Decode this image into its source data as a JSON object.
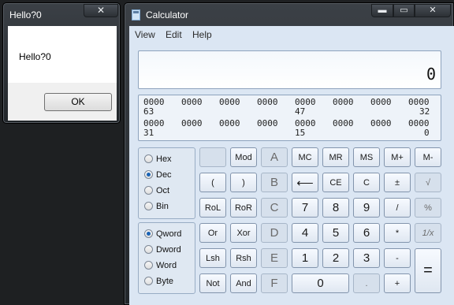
{
  "msgbox": {
    "title": "Hello?0",
    "close": "✕",
    "text": "Hello?0",
    "ok": "OK"
  },
  "calc": {
    "title": "Calculator",
    "controls": {
      "minimize": "▬",
      "maximize": "▭",
      "close": "✕"
    },
    "menu": [
      "View",
      "Edit",
      "Help"
    ],
    "display": "0",
    "bits": {
      "row1": [
        "0000",
        "0000",
        "0000",
        "0000",
        "0000",
        "0000",
        "0000",
        "0000"
      ],
      "row1_idx": [
        "63",
        "47",
        "32"
      ],
      "row2": [
        "0000",
        "0000",
        "0000",
        "0000",
        "0000",
        "0000",
        "0000",
        "0000"
      ],
      "row2_idx": [
        "31",
        "15",
        "0"
      ]
    },
    "base": {
      "options": [
        "Hex",
        "Dec",
        "Oct",
        "Bin"
      ],
      "selected": "Dec"
    },
    "word": {
      "options": [
        "Qword",
        "Dword",
        "Word",
        "Byte"
      ],
      "selected": "Qword"
    },
    "keys": {
      "mod": "Mod",
      "A": "A",
      "MC": "MC",
      "MR": "MR",
      "MS": "MS",
      "Mplus": "M+",
      "Mminus": "M-",
      "lparen": "(",
      "rparen": ")",
      "B": "B",
      "back": "⟵",
      "CE": "CE",
      "C": "C",
      "pm": "±",
      "sqrt": "√",
      "RoL": "RoL",
      "RoR": "RoR",
      "Ckey": "C",
      "7": "7",
      "8": "8",
      "9": "9",
      "div": "/",
      "pct": "%",
      "Or": "Or",
      "Xor": "Xor",
      "D": "D",
      "4": "4",
      "5": "5",
      "6": "6",
      "mul": "*",
      "recip": "1/x",
      "Lsh": "Lsh",
      "Rsh": "Rsh",
      "E": "E",
      "1": "1",
      "2": "2",
      "3": "3",
      "minus": "-",
      "eq": "=",
      "Not": "Not",
      "And": "And",
      "F": "F",
      "0": "0",
      "dot": ".",
      "plus": "+"
    }
  }
}
